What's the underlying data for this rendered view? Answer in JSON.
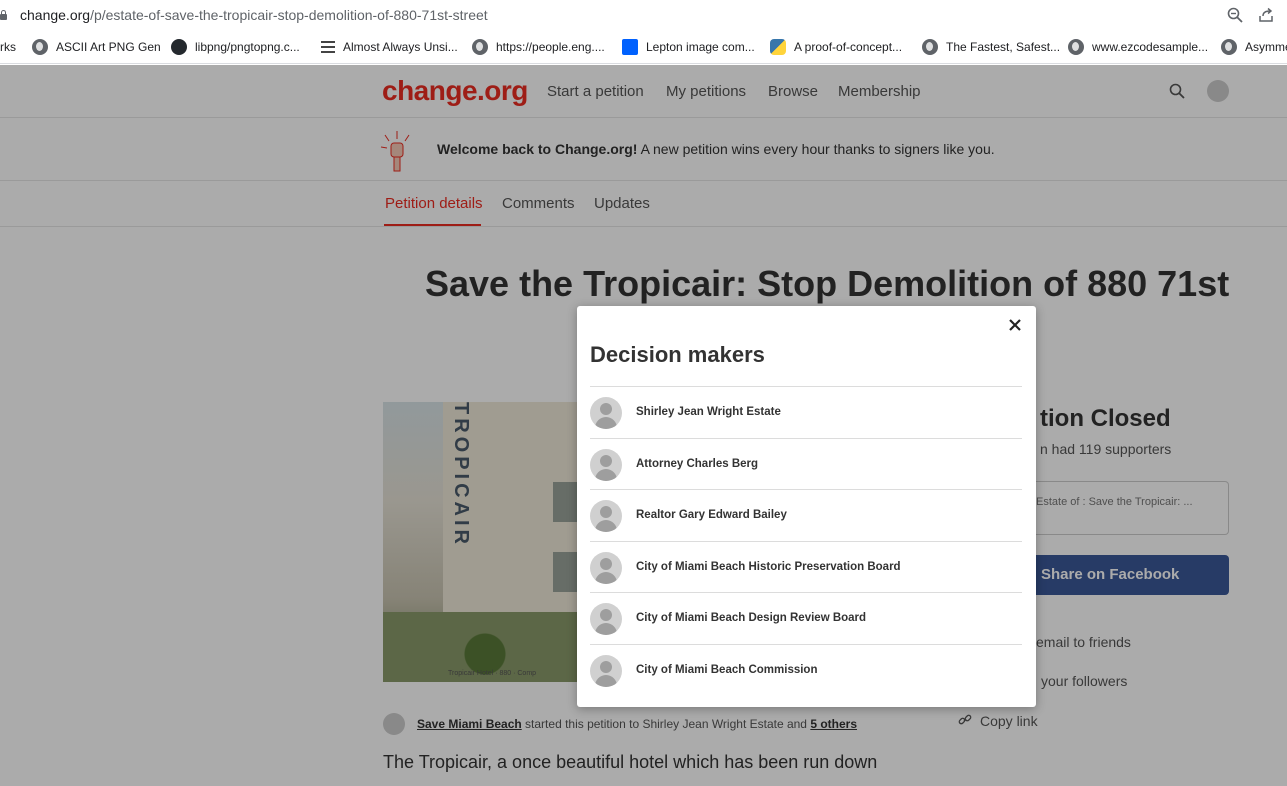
{
  "browser": {
    "url_host": "change.org",
    "url_path": "/p/estate-of-save-the-tropicair-stop-demolition-of-880-71st-street",
    "bookmarks": [
      {
        "label": "rks",
        "icon": "none"
      },
      {
        "label": "ASCII Art PNG Gen",
        "icon": "globe-icon"
      },
      {
        "label": "libpng/pngtopng.c...",
        "icon": "github-icon"
      },
      {
        "label": "Almost Always Unsi...",
        "icon": "lines-icon"
      },
      {
        "label": "https://people.eng....",
        "icon": "globe-icon"
      },
      {
        "label": "Lepton image com...",
        "icon": "dropbox-icon"
      },
      {
        "label": "A proof-of-concept...",
        "icon": "python-icon"
      },
      {
        "label": "The Fastest, Safest...",
        "icon": "globe-icon"
      },
      {
        "label": "www.ezcodesample...",
        "icon": "globe-icon"
      },
      {
        "label": "Asymme",
        "icon": "globe-icon"
      }
    ]
  },
  "site": {
    "logo": "change.org",
    "nav": {
      "start": "Start a petition",
      "my": "My petitions",
      "browse": "Browse",
      "membership": "Membership"
    },
    "welcome_bold": "Welcome back to Change.org!",
    "welcome_rest": " A new petition wins every hour thanks to signers like you.",
    "tabs": {
      "details": "Petition details",
      "comments": "Comments",
      "updates": "Updates"
    }
  },
  "petition": {
    "title": "Save the Tropicair: Stop Demolition of 880 71st",
    "photo_sign": "TROPICAIR",
    "photo_caption": "Tropicair Hotel · 880 · Comp",
    "closed": "tion Closed",
    "had_supporters": "n had 119 supporters",
    "share_text": "Estate of : Save the Tropicair: ...",
    "fb_button": "Share on Facebook",
    "email_link": "email to friends",
    "followers_link": "your followers",
    "copy_link": "Copy link",
    "starter_name": "Save Miami Beach",
    "starter_mid": " started this petition to Shirley Jean Wright Estate and ",
    "starter_others": "5 others",
    "description": "The Tropicair, a once beautiful hotel which has been run down"
  },
  "modal": {
    "title": "Decision makers",
    "items": [
      "Shirley Jean Wright Estate",
      "Attorney Charles Berg",
      "Realtor Gary Edward Bailey",
      "City of Miami Beach Historic Preservation Board",
      "City of Miami Beach Design Review Board",
      "City of Miami Beach Commission"
    ]
  },
  "colors": {
    "brand": "#ec2c22",
    "facebook": "#3b5998",
    "overlay": "rgba(0,0,0,0.33)"
  }
}
